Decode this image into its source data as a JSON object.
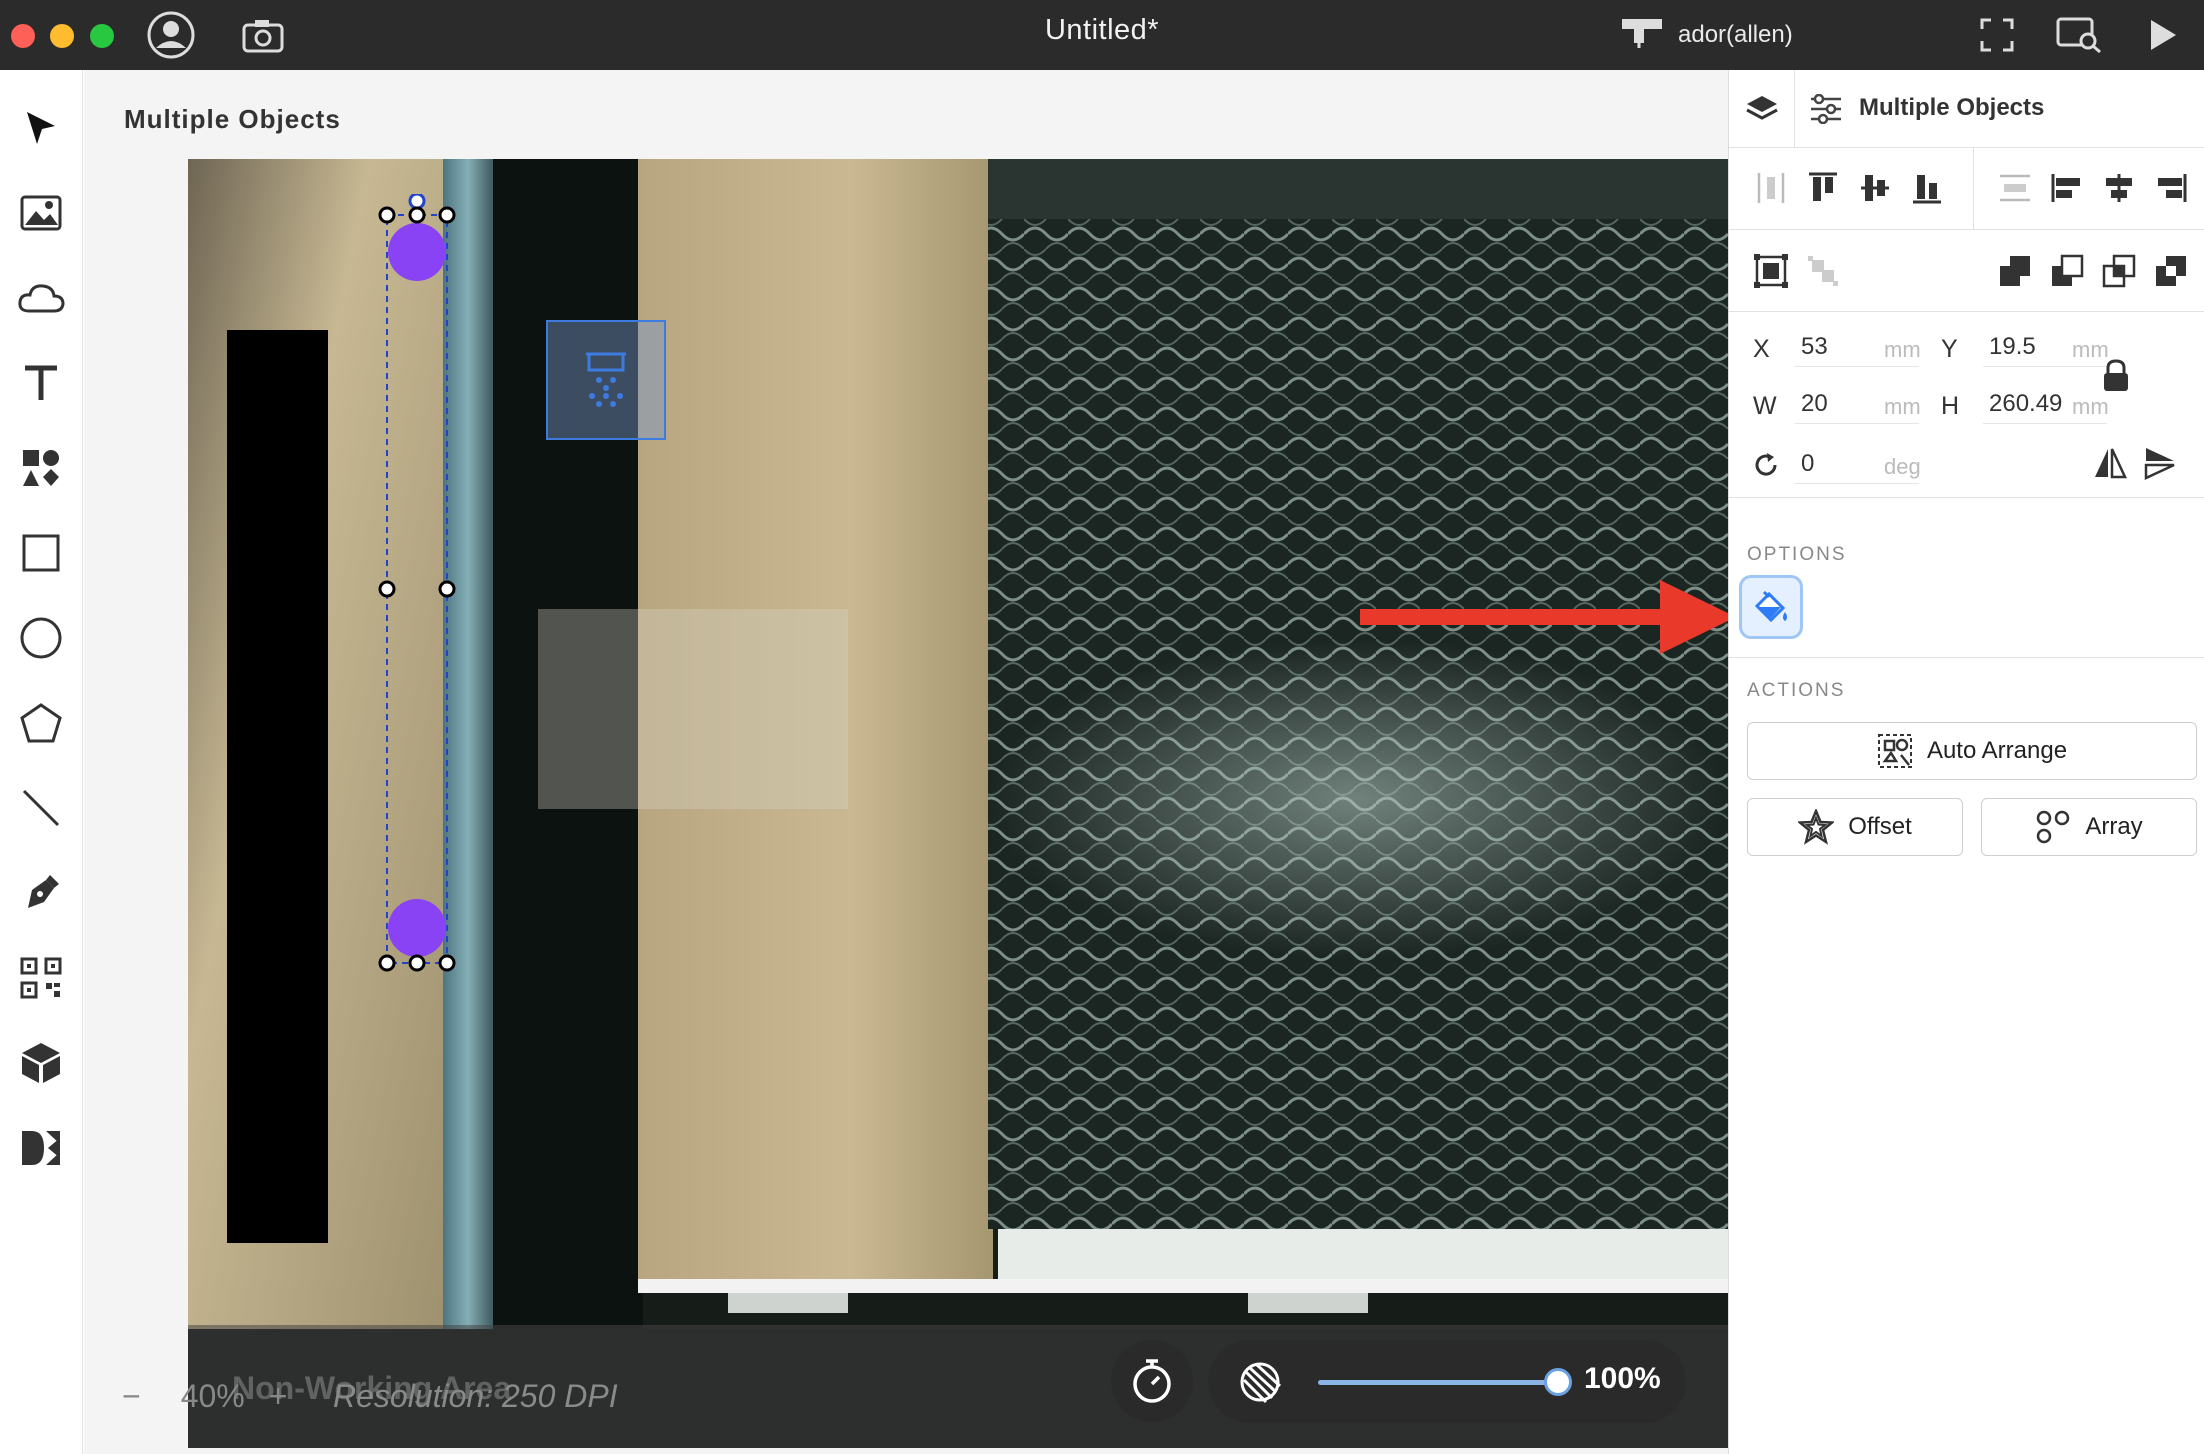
{
  "window": {
    "title": "Untitled*"
  },
  "titlebar": {
    "account_icon": "user-circle-icon",
    "camera_icon": "camera-icon",
    "machine_name": "ador(allen)",
    "machine_icon": "laser-machine-icon",
    "fullscreen_icon": "fullscreen-icon",
    "preview_icon": "path-preview-icon",
    "run_icon": "play-icon"
  },
  "tools": [
    "cursor-icon",
    "image-icon",
    "cloud-icon",
    "text-icon",
    "elements-icon",
    "rectangle-icon",
    "ellipse-icon",
    "polygon-icon",
    "line-icon",
    "pen-icon",
    "qr-code-icon",
    "box-icon",
    "dmkt-icon"
  ],
  "workspace": {
    "title": "Multiple Objects",
    "non_working_area": "Non-Working Area",
    "zoom": {
      "minus": "−",
      "value": "40%",
      "plus": "+"
    },
    "resolution": "Resolution: 250 DPI",
    "camera_opacity": "100%",
    "camera_opacity_fraction": 1.0
  },
  "panel": {
    "title": "Multiple Objects",
    "position": {
      "x_label": "X",
      "x_value": "53",
      "x_unit": "mm",
      "y_label": "Y",
      "y_value": "19.5",
      "y_unit": "mm",
      "w_label": "W",
      "w_value": "20",
      "w_unit": "mm",
      "h_label": "H",
      "h_value": "260.49",
      "h_unit": "mm",
      "rotation_value": "0",
      "rotation_unit": "deg"
    },
    "options_title": "OPTIONS",
    "actions_title": "ACTIONS",
    "auto_arrange": "Auto Arrange",
    "offset": "Offset",
    "array": "Array"
  },
  "colors": {
    "accent": "#2d7cf6",
    "selection_dots": "#8a42f5",
    "annotation_arrow": "#e8392b",
    "titlebar": "#2b2b2b"
  }
}
